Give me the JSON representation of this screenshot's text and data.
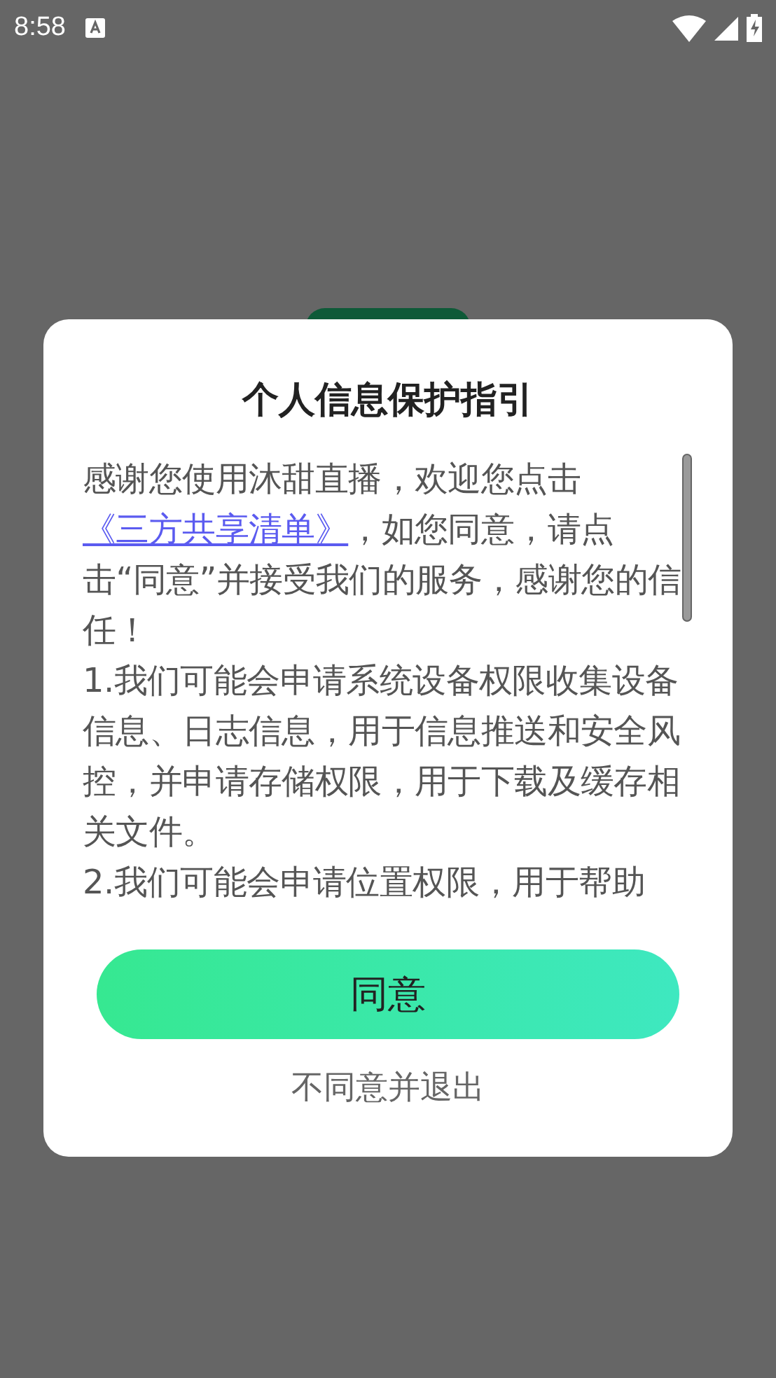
{
  "status_bar": {
    "time": "8:58"
  },
  "dialog": {
    "title": "个人信息保护指引",
    "intro": {
      "before": "感谢您使用沐甜直播，欢迎您点击",
      "link": "《三方共享清单》",
      "after": "，如您同意，请点击“同意”并接受我们的服务，感谢您的信任！"
    },
    "paragraphs": [
      "1.我们可能会申请系统设备权限收集设备信息、日志信息，用于信息推送和安全风控，并申请存储权限，用于下载及缓存相关文件。",
      "2.我们可能会申请位置权限，用于帮助"
    ],
    "agree_button": "同意",
    "decline_link": "不同意并退出"
  }
}
